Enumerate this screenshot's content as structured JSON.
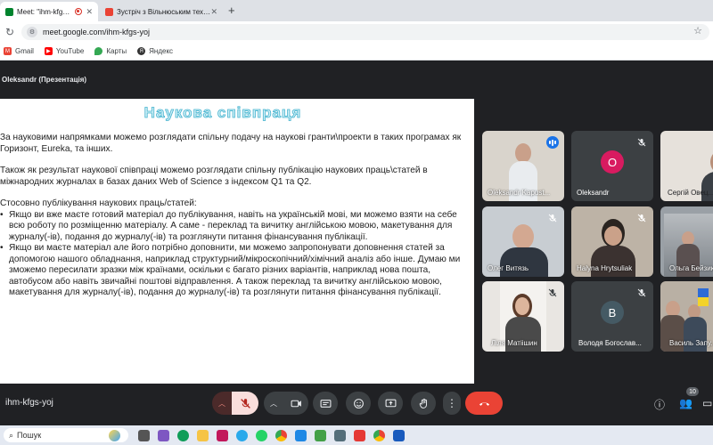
{
  "browser": {
    "tabs": [
      {
        "title": "Meet: \"ihm-kfgs-yoj\"",
        "active": true,
        "recording": true
      },
      {
        "title": "Зустріч з Вільнюським технічним",
        "active": false
      }
    ],
    "new_tab": "+",
    "url": "meet.google.com/ihm-kfgs-yoj",
    "bookmarks": [
      {
        "label": "Gmail",
        "icon": "gmail-icon",
        "color": "#ea4335"
      },
      {
        "label": "YouTube",
        "icon": "youtube-icon",
        "color": "#ff0000"
      },
      {
        "label": "Карты",
        "icon": "maps-icon",
        "color": "#34a853"
      },
      {
        "label": "Яндекс",
        "icon": "yandex-icon",
        "color": "#333333"
      }
    ]
  },
  "meet": {
    "presenter_label": "Oleksandr (Презентація)",
    "meeting_code": "ihm-kfgs-yoj",
    "participants_count": "10",
    "slide": {
      "title": "Наукова співпраця",
      "paragraphs": [
        "За науковими напрямками можемо розглядати спільну подачу на наукові гранти\\проекти в таких програмах як Горизонт, Eureka, та інших.",
        "Також як результат наукової співпраці можемо розглядати спільну публікацію наукових праць\\статей в міжнародних журналах в базах даних Web of Science з індексом Q1 та Q2."
      ],
      "section_heading": "Стосовно публікування наукових праць/статей:",
      "bullets": [
        "Якщо ви вже маєте готовий матеріал до публікування, навіть на українській мові, ми можемо взяти на себе всю роботу по розміщенню матеріалу. А саме - переклад та вичитку англійською мовою, макетування для журналу(-ів), подання до журналу(-ів) та розглянути питання фінансування публікації.",
        "Якщо ви маєте матеріал але його потрібно доповнити, ми можемо запропонувати доповнення статей за допомогою нашого обладнання, наприклад структурний/мікроскопічний/хімічний аналіз або інше. Думаю ми зможемо пересилати зразки між країнами, оскільки є багато різних варіантів, наприклад нова пошта, автобусом або навіть звичайні поштові відправлення. А також переклад та вичитку англійською мовою, макетування для журналу(-ів), подання до журналу(-ів) та розглянути питання фінансування публікації."
      ]
    },
    "participants": [
      {
        "name": "Oleksandr Kapust...",
        "type": "video",
        "speaking": true,
        "bg": "#d9d4cc"
      },
      {
        "name": "Oleksandr",
        "type": "avatar",
        "initial": "O",
        "avatar_color": "#d81b60",
        "muted": true
      },
      {
        "name": "Сергій Овец...",
        "type": "video",
        "muted": true,
        "bg": "#e6e1db"
      },
      {
        "name": "Олег Витязь",
        "type": "video",
        "muted": true,
        "bg": "#c8cdd2"
      },
      {
        "name": "Halyna Hrytsuliak",
        "type": "video",
        "muted": true,
        "bg": "#bdb3a6"
      },
      {
        "name": "Ольга Бейзик",
        "type": "video",
        "muted": true,
        "bg": "#9aa0a6"
      },
      {
        "name": "Ліля Матіішин",
        "type": "video",
        "muted": true,
        "bg": "#e9e6e2"
      },
      {
        "name": "Володя Богослав...",
        "type": "avatar",
        "initial": "B",
        "avatar_color": "#455a64",
        "muted": true
      },
      {
        "name": "Василь Запу...",
        "type": "video",
        "muted": false,
        "bg": "#b9b0a4"
      }
    ]
  },
  "taskbar": {
    "search_label": "Пошук"
  }
}
